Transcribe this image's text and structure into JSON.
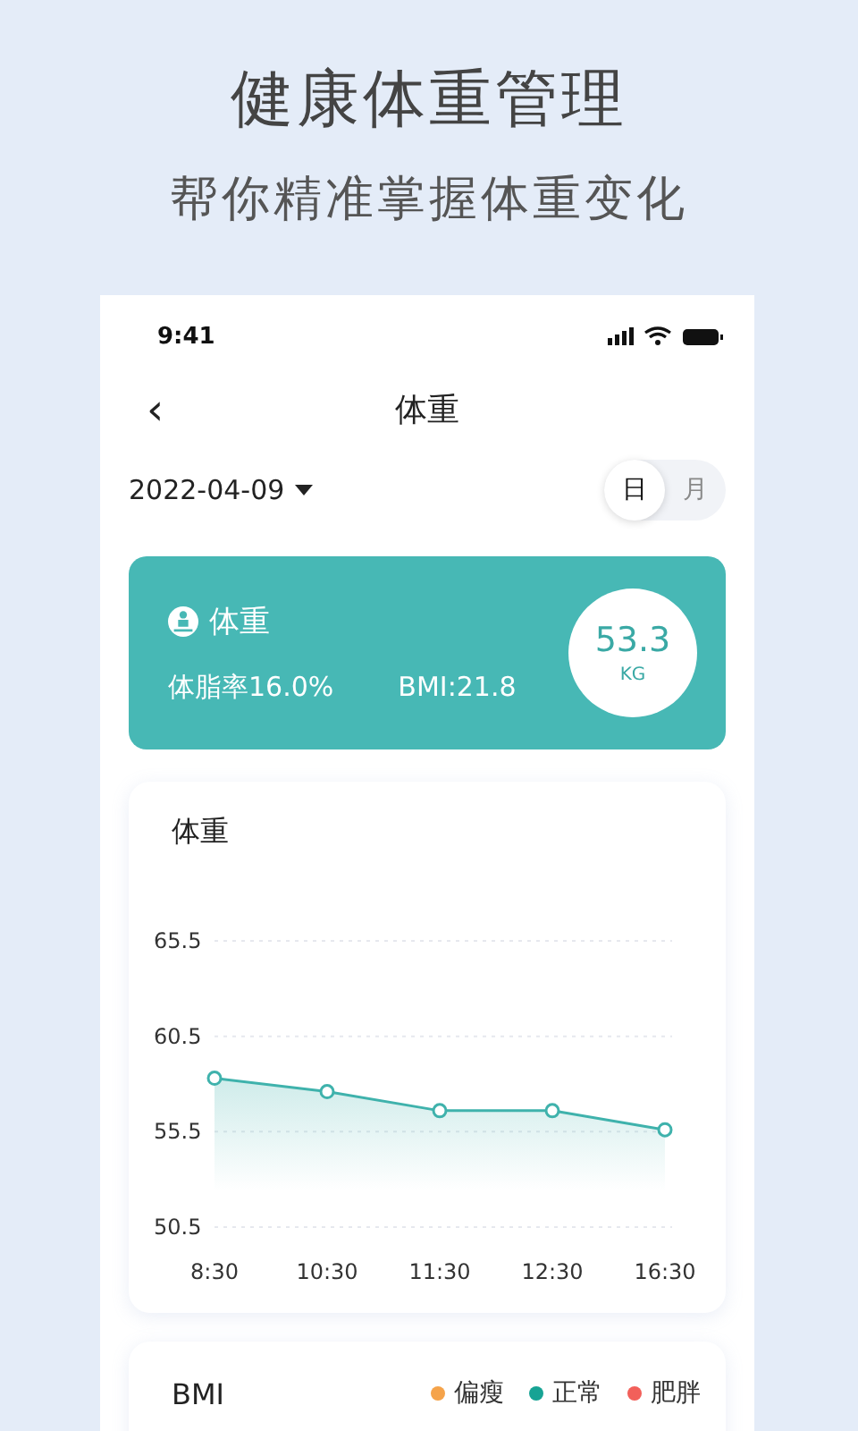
{
  "headline": "健康体重管理",
  "subheadline": "帮你精准掌握体重变化",
  "status_bar": {
    "time": "9:41"
  },
  "nav": {
    "back": "‹",
    "title": "体重"
  },
  "date_picker": {
    "value": "2022-04-09"
  },
  "period_tabs": [
    {
      "label": "日",
      "selected": true
    },
    {
      "label": "月",
      "selected": false
    }
  ],
  "summary": {
    "title": "体重",
    "body_fat": "体脂率16.0%",
    "bmi": "BMI:21.8",
    "weight": "53.3",
    "unit": "KG"
  },
  "weight_chart": {
    "title": "体重",
    "chart_data": {
      "type": "area",
      "categories": [
        "8:30",
        "10:30",
        "11:30",
        "12:30",
        "16:30"
      ],
      "series": [
        {
          "color": "#3fb2ac",
          "values": [
            58.3,
            57.6,
            56.6,
            56.6,
            55.6
          ]
        }
      ],
      "ylim": [
        50.5,
        65.5
      ],
      "yticks": [
        50.5,
        55.5,
        60.5,
        65.5
      ]
    }
  },
  "bmi_card": {
    "title": "BMI",
    "legend": [
      {
        "label": "偏瘦",
        "color": "#f5a34a"
      },
      {
        "label": "正常",
        "color": "#17a394"
      },
      {
        "label": "肥胖",
        "color": "#f2605a"
      }
    ]
  }
}
